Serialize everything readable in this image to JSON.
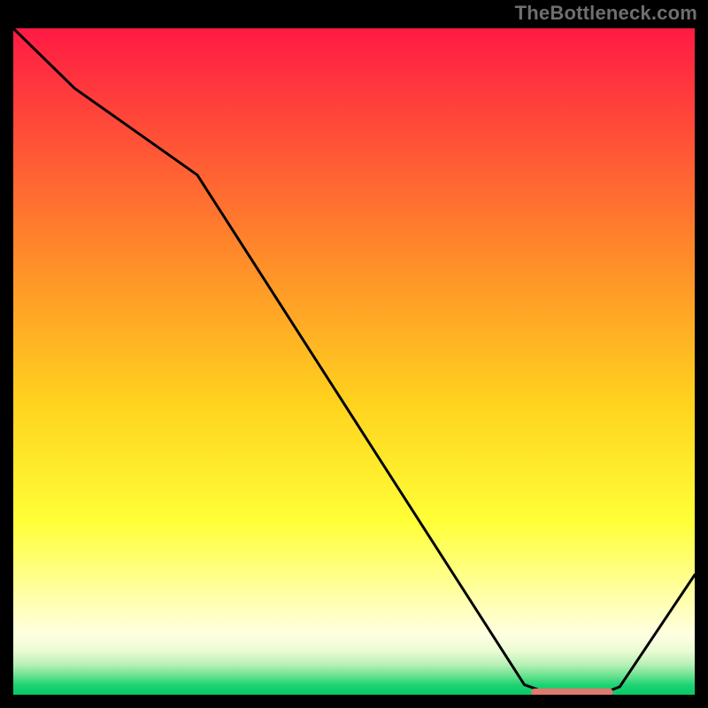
{
  "watermark": "TheBottleneck.com",
  "chart_data": {
    "type": "line",
    "title": "",
    "xlabel": "",
    "ylabel": "",
    "xlim": [
      0,
      100
    ],
    "ylim": [
      0,
      100
    ],
    "series": [
      {
        "name": "curve",
        "x": [
          0,
          9,
          27,
          75,
          78,
          87,
          89,
          100
        ],
        "y": [
          100,
          91,
          78,
          1.5,
          0.4,
          0.4,
          1.2,
          18
        ]
      }
    ],
    "marker": {
      "x_start": 76,
      "x_end": 88,
      "y": 0.4,
      "color": "#e0796e"
    },
    "background": {
      "type": "vertical-gradient",
      "stops": [
        {
          "pos": 0.0,
          "color": "#ff1a44"
        },
        {
          "pos": 0.34,
          "color": "#ff8a2a"
        },
        {
          "pos": 0.56,
          "color": "#ffd21e"
        },
        {
          "pos": 0.74,
          "color": "#ffff37"
        },
        {
          "pos": 0.86,
          "color": "#ffffb0"
        },
        {
          "pos": 0.91,
          "color": "#ffffe2"
        },
        {
          "pos": 0.935,
          "color": "#e9fbd2"
        },
        {
          "pos": 0.955,
          "color": "#b7f0b6"
        },
        {
          "pos": 0.972,
          "color": "#66e28d"
        },
        {
          "pos": 0.985,
          "color": "#1fd374"
        },
        {
          "pos": 1.0,
          "color": "#07c765"
        }
      ]
    }
  }
}
